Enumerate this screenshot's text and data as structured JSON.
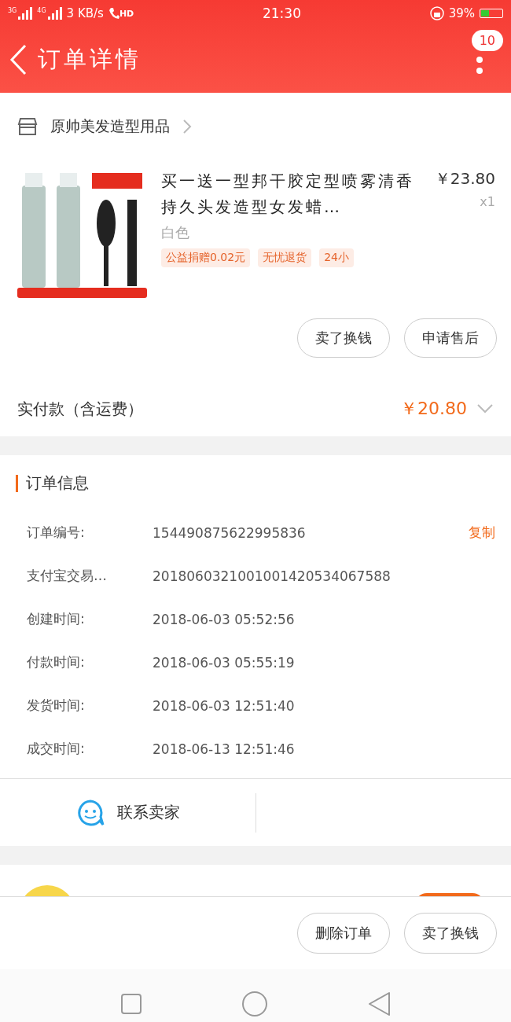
{
  "status_bar": {
    "network_1": "3G",
    "network_2": "4G",
    "speed": "3 KB/s",
    "call": "HD",
    "time": "21:30",
    "battery": "39%"
  },
  "header": {
    "title": "订单详情",
    "badge": "10"
  },
  "shop": {
    "name": "原帅美发造型用品"
  },
  "item": {
    "kind": "picture",
    "title": "买一送一型邦干胶定型喷雾清香持久头发造型女发蜡…",
    "variant": "白色",
    "price": "￥23.80",
    "quantity": "x1",
    "tags": [
      "公益捐赠0.02元",
      "无忧退货",
      "24小"
    ]
  },
  "item_actions": [
    "卖了换钱",
    "申请售后"
  ],
  "payment": {
    "label": "实付款（含运费）",
    "amount": "￥20.80"
  },
  "order_info": {
    "title": "订单信息",
    "copy": "复制",
    "rows": [
      {
        "label": "订单编号:",
        "value": "154490875622995836"
      },
      {
        "label": "支付宝交易…",
        "value": "2018060321001001420534067588"
      },
      {
        "label": "创建时间:",
        "value": "2018-06-03 05:52:56"
      },
      {
        "label": "付款时间:",
        "value": "2018-06-03 05:55:19"
      },
      {
        "label": "发货时间:",
        "value": "2018-06-03 12:51:40"
      },
      {
        "label": "成交时间:",
        "value": "2018-06-13 12:51:46"
      }
    ]
  },
  "contact": {
    "label": "联系卖家"
  },
  "footer_actions": [
    "删除订单",
    "卖了换钱"
  ]
}
